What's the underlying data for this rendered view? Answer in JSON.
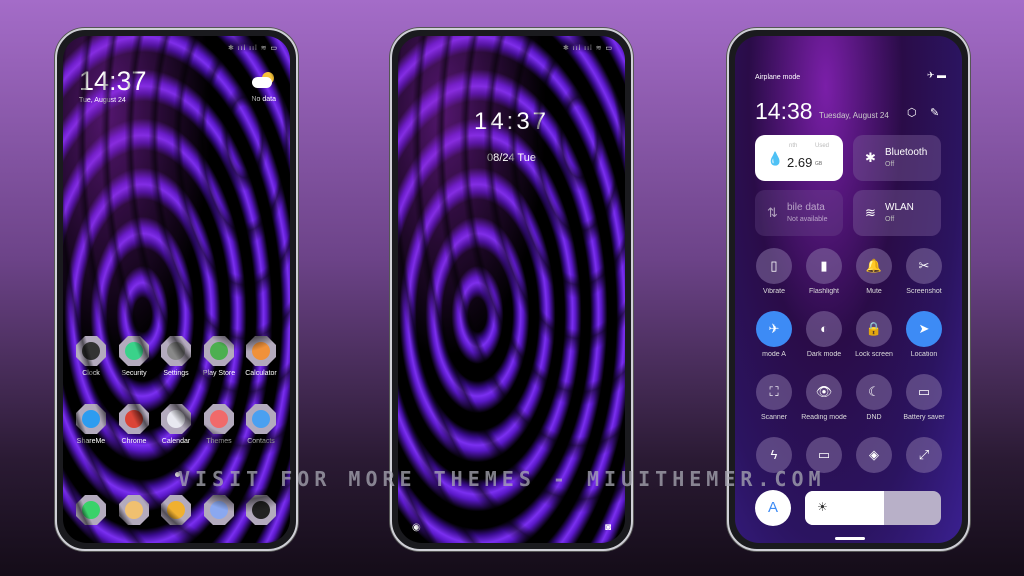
{
  "home": {
    "status": "✱ ııl ııl ≋ ▭",
    "time": "14:37",
    "date": "Tue, August 24",
    "weather": "No data",
    "apps": [
      {
        "label": "Clock",
        "color": "#333"
      },
      {
        "label": "Security",
        "color": "#3ad28a"
      },
      {
        "label": "Settings",
        "color": "#888"
      },
      {
        "label": "Play Store",
        "color": "#4caf50"
      },
      {
        "label": "Calculator",
        "color": "#f0913a"
      },
      {
        "label": "ShareMe",
        "color": "#2d9cf0"
      },
      {
        "label": "Chrome",
        "color": "#db4437"
      },
      {
        "label": "Calendar",
        "color": "#e8e8f0"
      },
      {
        "label": "Themes",
        "color": "#f06a6a"
      },
      {
        "label": "Contacts",
        "color": "#4aa0f0"
      }
    ],
    "dock": [
      {
        "name": "phone",
        "color": "#3ad26a"
      },
      {
        "name": "messages",
        "color": "#f0c070"
      },
      {
        "name": "notes",
        "color": "#f0b030"
      },
      {
        "name": "browser",
        "color": "#8aa8f0"
      },
      {
        "name": "camera",
        "color": "#222"
      }
    ]
  },
  "lock": {
    "status": "✱ ııl ııl ≋ ▭",
    "time": "14:37",
    "date": "08/24 Tue"
  },
  "control": {
    "mode": "Airplane mode",
    "time": "14:38",
    "date": "Tuesday, August 24",
    "data_tile": {
      "left": "nth",
      "right": "Used",
      "value": "2.69",
      "unit": "GB"
    },
    "bluetooth": {
      "title": "Bluetooth",
      "state": "Off"
    },
    "mobile": {
      "title": "bile data",
      "state": "Not available"
    },
    "wlan": {
      "title": "WLAN",
      "state": "Off"
    },
    "buttons": [
      {
        "label": "Vibrate",
        "icon": "▯",
        "on": false
      },
      {
        "label": "Flashlight",
        "icon": "▮",
        "on": false
      },
      {
        "label": "Mute",
        "icon": "🔔",
        "on": false
      },
      {
        "label": "Screenshot",
        "icon": "✂",
        "on": false
      },
      {
        "label": "mode  A",
        "icon": "✈",
        "on": true
      },
      {
        "label": "Dark mode",
        "icon": "◐",
        "on": false
      },
      {
        "label": "Lock screen",
        "icon": "🔒",
        "on": false
      },
      {
        "label": "Location",
        "icon": "➤",
        "on": true
      },
      {
        "label": "Scanner",
        "icon": "⛶",
        "on": false
      },
      {
        "label": "Reading mode",
        "icon": "👁",
        "on": false
      },
      {
        "label": "DND",
        "icon": "☾",
        "on": false
      },
      {
        "label": "Battery saver",
        "icon": "▭",
        "on": false
      },
      {
        "label": "",
        "icon": "ϟ",
        "on": false
      },
      {
        "label": "",
        "icon": "▭",
        "on": false
      },
      {
        "label": "",
        "icon": "◈",
        "on": false
      },
      {
        "label": "",
        "icon": "⤢",
        "on": false
      }
    ],
    "auto_label": "A",
    "brightness": 0.58
  },
  "watermark": "VISIT FOR MORE THEMES - MIUITHEMER.COM"
}
